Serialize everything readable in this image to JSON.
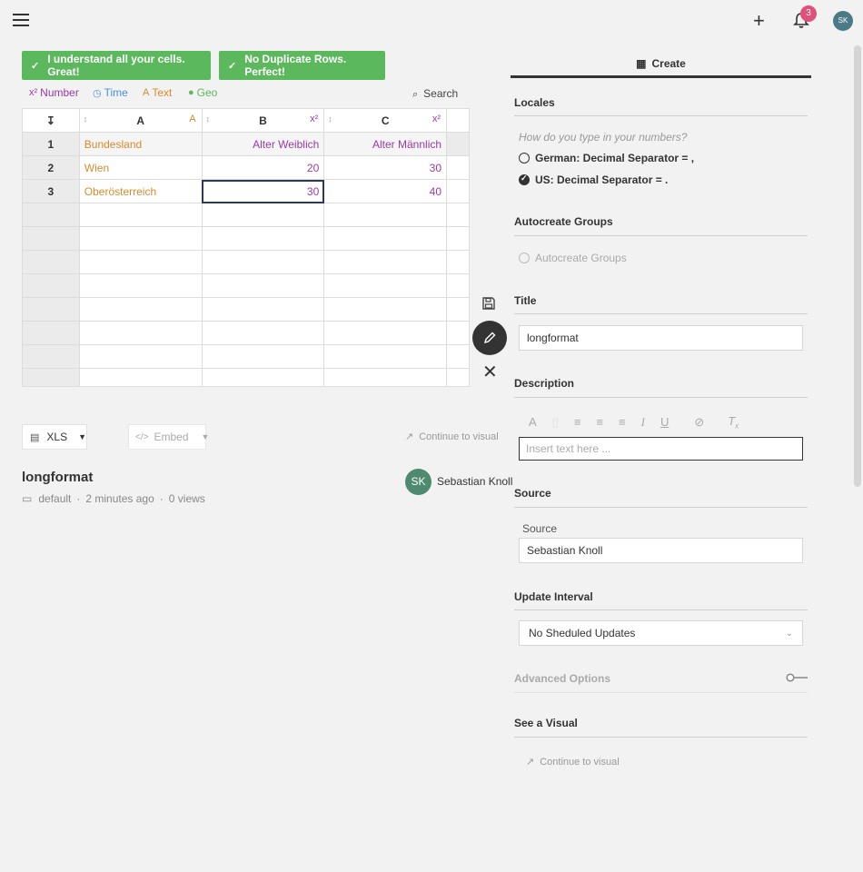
{
  "topbar": {
    "notifications_count": "3",
    "user_initials": "SK"
  },
  "validation": {
    "cells_ok": "I understand all your cells. Great!",
    "rows_ok": "No Duplicate Rows. Perfect!"
  },
  "types": {
    "number": "Number",
    "number_glyph": "x²",
    "time": "Time",
    "text": "Text",
    "geo": "Geo"
  },
  "search_label": "Search",
  "sheet": {
    "columns": [
      "A",
      "B",
      "C"
    ],
    "rows": [
      {
        "n": "1",
        "a": "Bundesland",
        "b": "Alter Weiblich",
        "c": "Alter Männlich"
      },
      {
        "n": "2",
        "a": "Wien",
        "b": "20",
        "c": "30"
      },
      {
        "n": "3",
        "a": "Oberösterreich",
        "b": "30",
        "c": "40"
      }
    ],
    "sort_glyph": "↕"
  },
  "export": {
    "format": "XLS",
    "embed": "Embed",
    "continue": "Continue to visual"
  },
  "dataset": {
    "title": "longformat",
    "folder": "default",
    "time_ago": "2 minutes ago",
    "views": "0 views",
    "author": "Sebastian Knoll",
    "author_initials": "SK"
  },
  "panel": {
    "tab": "Create",
    "locales_heading": "Locales",
    "locales_hint": "How do you type in your numbers?",
    "locale_german": "German: Decimal Separator = ,",
    "locale_us": "US: Decimal Separator = .",
    "autocreate_heading": "Autocreate Groups",
    "autocreate_option": "Autocreate Groups",
    "title_heading": "Title",
    "title_value": "longformat",
    "description_heading": "Description",
    "description_placeholder": "Insert text here ...",
    "source_heading": "Source",
    "source_label": "Source",
    "source_value": "Sebastian Knoll",
    "update_heading": "Update Interval",
    "update_value": "No Sheduled Updates",
    "advanced": "Advanced Options",
    "see_visual": "See a Visual",
    "continue": "Continue to visual"
  },
  "colors": {
    "success": "#5cb85c",
    "text_type": "#d98a2b",
    "number_type": "#9b3aa8",
    "time_type": "#4a90d9",
    "geo_type": "#5cb85c",
    "badge": "#e0507a"
  }
}
